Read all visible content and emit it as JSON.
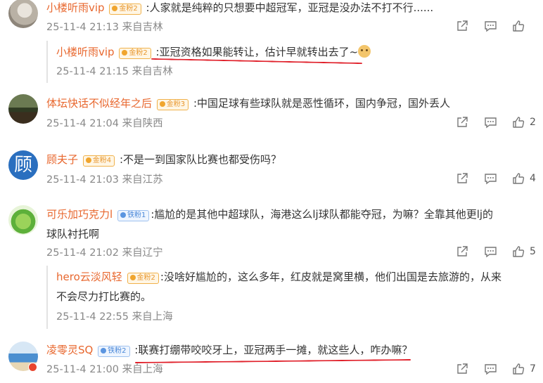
{
  "comments": [
    {
      "user": "小楼听雨vip",
      "badge": "金粉2",
      "text": ":人家就是纯粹的只想要中超冠军，亚冠是没办法不打不行......",
      "meta": "25-11-4 21:13 来自吉林",
      "likes": "",
      "reply": {
        "user": "小楼听雨vip",
        "badge": "金粉2",
        "text": ":亚冠资格如果能转让，估计早就转出去了~",
        "meta": "25-11-4 21:15 来自吉林"
      }
    },
    {
      "user": "体坛快话不似经年之后",
      "badge": "金粉3",
      "text": ":中国足球有些球队就是恶性循环，国内争冠，国外丢人",
      "meta": "25-11-4 21:04 来自陕西",
      "likes": "2"
    },
    {
      "user": "顾夫子",
      "badge": "金粉4",
      "text": ":不是一到国家队比赛也都受伤吗？",
      "meta": "25-11-4 21:03 来自江苏",
      "likes": "4",
      "avatar_char": "顾"
    },
    {
      "user": "可乐加巧克力l",
      "badge": "铁粉1",
      "text_line1": ":尴尬的是其他中超球队，海港这么lj球队都能夺冠，为嘛？全靠其他更lj的",
      "text_line2": "球队衬托啊",
      "meta": "25-11-4 21:02 来自辽宁",
      "likes": "5",
      "reply": {
        "user": "hero云淡风轻",
        "badge": "金粉2",
        "text_line1": ":没啥好尴尬的，这么多年，红皮就是窝里横，他们出国是去旅游的，从来",
        "text_line2": "不会尽力打比赛的。",
        "meta": "25-11-4 22:55 来自上海"
      }
    },
    {
      "user": "凌零灵SQ",
      "badge": "铁粉2",
      "text": ":联赛打绷带咬咬牙上，亚冠两手一摊，就这些人，咋办嘛？",
      "meta": "25-11-4 21:00 来自上海",
      "likes": "7"
    }
  ],
  "colors": {
    "username": "#e8672e",
    "underline": "#e0202a",
    "meta": "#888888"
  },
  "icons": {
    "share": "share-icon",
    "comment": "comment-icon",
    "like": "thumbs-up-icon"
  }
}
